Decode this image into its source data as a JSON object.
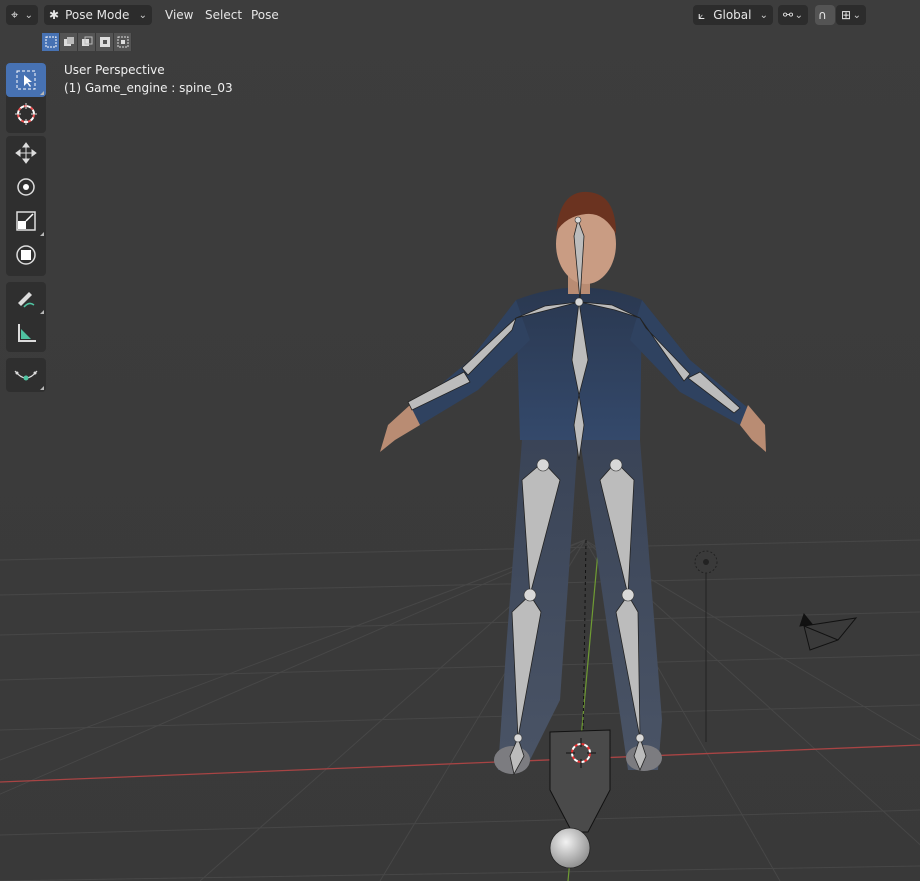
{
  "header": {
    "editor_type_icon": "object-transform-icon",
    "mode_label": "Pose Mode",
    "menus": [
      "View",
      "Select",
      "Pose"
    ],
    "orientation_label": "Global"
  },
  "toolbar": {
    "tools": [
      "select-box-icon",
      "cursor-icon",
      "move-icon",
      "rotate-icon",
      "scale-icon",
      "transform-icon",
      "annotate-icon",
      "measure-icon",
      "relax-icon"
    ],
    "active_tool": "select-box-icon"
  },
  "viewport": {
    "view_name": "User Perspective",
    "object_info": "(1) Game_engine : spine_03"
  },
  "colors": {
    "accent": "#4772b3",
    "background": "#3d3d3d",
    "x_axis": "#c44a4a",
    "y_axis": "#7fb03a"
  }
}
